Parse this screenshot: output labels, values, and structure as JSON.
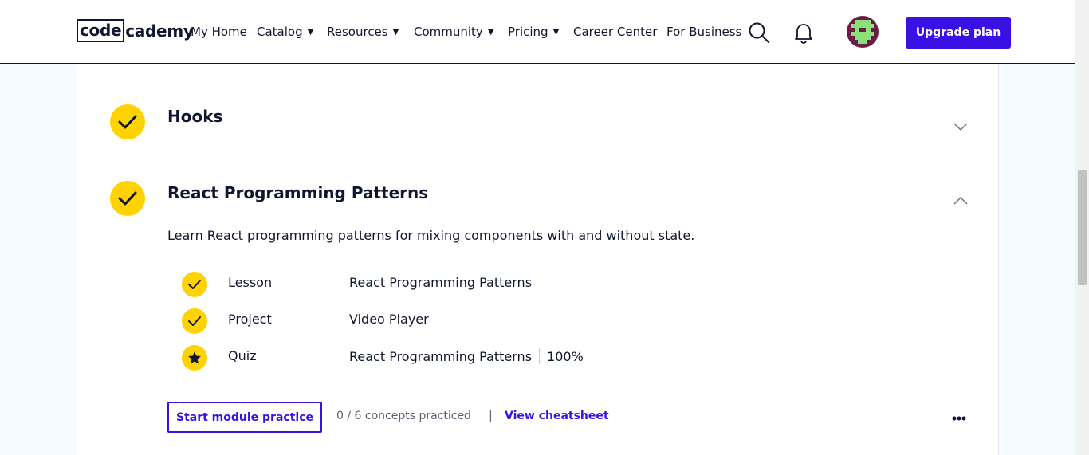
{
  "nav": {
    "logo_code": "code",
    "logo_rest": "cademy",
    "my_home": "My Home",
    "catalog": "Catalog",
    "resources": "Resources",
    "community": "Community",
    "pricing": "Pricing",
    "career_center": "Career Center",
    "for_business": "For Business",
    "upgrade": "Upgrade plan",
    "caret": "▼"
  },
  "modules": [
    {
      "title": "Hooks",
      "completed": true,
      "expanded": false
    },
    {
      "title": "React Programming Patterns",
      "completed": true,
      "expanded": true,
      "description": "Learn React programming patterns for mixing components with and without state.",
      "items": [
        {
          "type": "Lesson",
          "name": "React Programming Patterns",
          "status": "check"
        },
        {
          "type": "Project",
          "name": "Video Player",
          "status": "check"
        },
        {
          "type": "Quiz",
          "name": "React Programming Patterns",
          "score": "100%",
          "status": "star"
        }
      ],
      "practice_button": "Start module practice",
      "concepts": "0 / 6 concepts practiced",
      "separator": "|",
      "cheatsheet": "View cheatsheet"
    }
  ],
  "colors": {
    "accent": "#3a10e5",
    "badge": "#ffd300",
    "text": "#10162f",
    "page_bg": "#f5fcff"
  },
  "icons": [
    "search-icon",
    "bell-icon",
    "check-icon",
    "star-icon",
    "chevron-down-icon",
    "chevron-up-icon",
    "more-icon"
  ]
}
